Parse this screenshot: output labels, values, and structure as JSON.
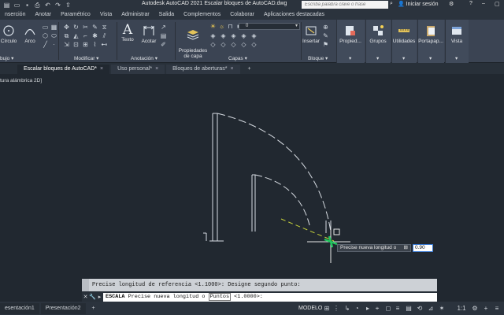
{
  "titlebar": {
    "title": "Autodesk AutoCAD 2021   Escalar bloques de AutoCAD.dwg",
    "search_placeholder": "Escriba palabra clave o frase",
    "signin": "Iniciar sesión",
    "quick_access_icons": [
      "open-icon",
      "save-icon",
      "print-icon",
      "undo-icon",
      "redo-icon",
      "share-icon"
    ]
  },
  "ribbon_tabs": [
    "nserción",
    "Anotar",
    "Paramétrico",
    "Vista",
    "Administrar",
    "Salida",
    "Complementos",
    "Colaborar",
    "Aplicaciones destacadas"
  ],
  "ribbon": {
    "buttons": {
      "circle": "Círculo",
      "arc": "Arco",
      "text": "Texto",
      "dimension": "Acotar",
      "layer_props": "Propiedades\nde capa",
      "insert": "Insertar",
      "properties": "Propied...",
      "groups": "Grupos",
      "utilities": "Utilidades",
      "clipboard": "Portapap...",
      "view": "Vista"
    },
    "groups": {
      "draw": "bujo",
      "modify": "Modificar",
      "annotation": "Anotación",
      "layers": "Capas",
      "block": "Bloque"
    },
    "layer_current": "0"
  },
  "doc_tabs": [
    {
      "label": "Escalar bloques de AutoCAD*",
      "active": true
    },
    {
      "label": "Uso personal*",
      "active": false
    },
    {
      "label": "Bloques de aberturas*",
      "active": false
    }
  ],
  "viewport": {
    "label": "tura alámbrica 2D]",
    "dynamic_prompt": "Precise nueva longitud o",
    "dynamic_value": "0.90"
  },
  "command": {
    "history": "Precise longitud de referencia <1.1000>:  Designe segundo punto:",
    "current_cmd": "ESCALA",
    "current_text": "Precise nueva longitud o",
    "option": "Puntos",
    "default": "<1.0000>:"
  },
  "statusbar": {
    "layouts": [
      "esentación1",
      "Presentación2"
    ],
    "model": "MODELO",
    "scale": "1:1"
  },
  "colors": {
    "background": "#212830",
    "ribbon": "#3b4453",
    "cursor": "#22c55e",
    "dashed_line": "#c6d23a"
  }
}
